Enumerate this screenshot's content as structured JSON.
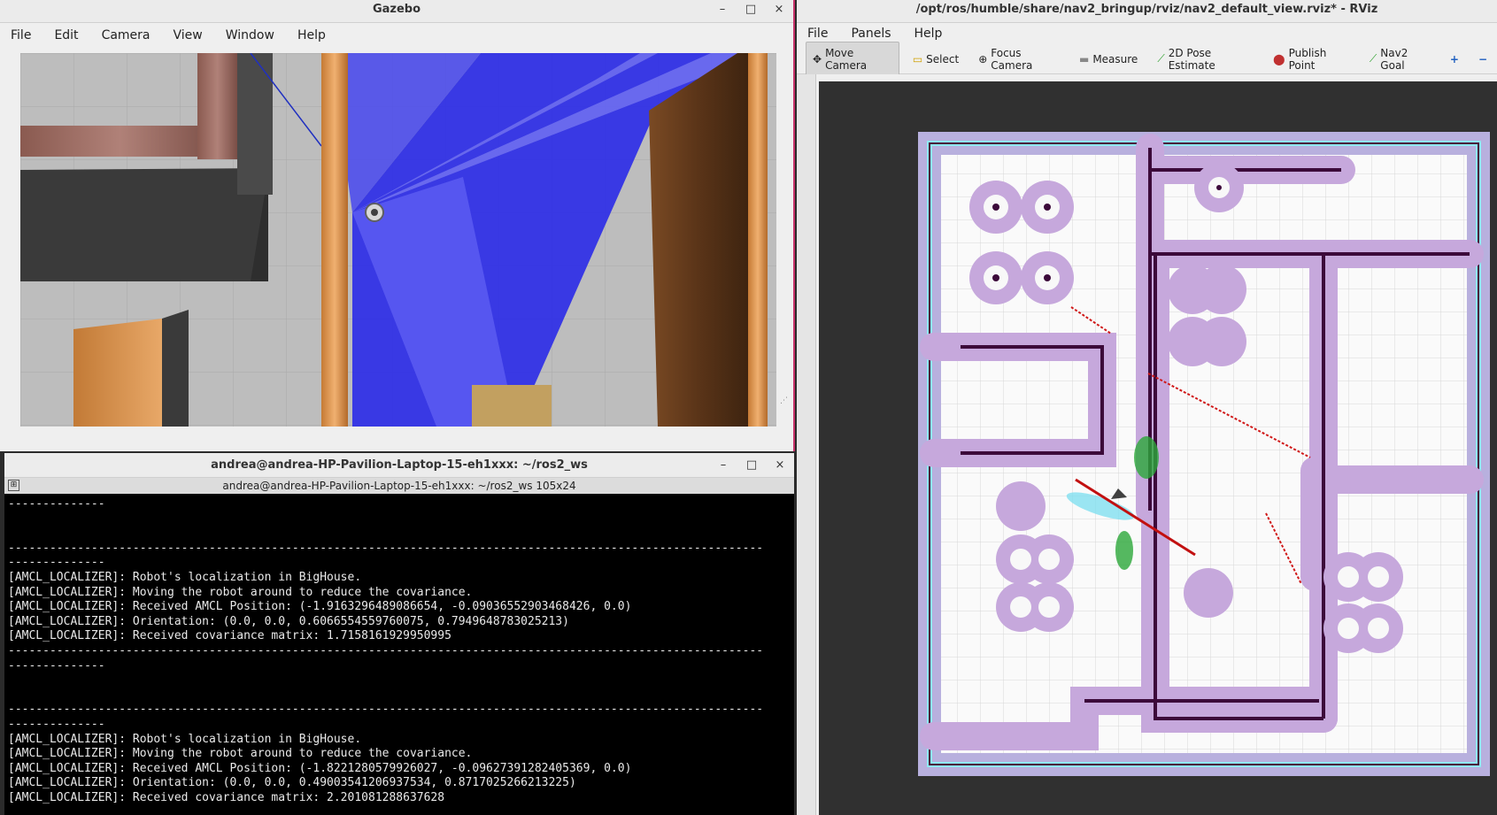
{
  "gazebo": {
    "title": "Gazebo",
    "menu": [
      "File",
      "Edit",
      "Camera",
      "View",
      "Window",
      "Help"
    ],
    "controls": {
      "minimize": "–",
      "maximize": "□",
      "close": "×"
    }
  },
  "terminal": {
    "title": "andrea@andrea-HP-Pavilion-Laptop-15-eh1xxx: ~/ros2_ws",
    "tab_title": "andrea@andrea-HP-Pavilion-Laptop-15-eh1xxx: ~/ros2_ws 105x24",
    "controls": {
      "minimize": "–",
      "maximize": "□",
      "close": "×"
    },
    "lines": [
      "--------------",
      "",
      "",
      "-------------------------------------------------------------------------------------------------------------",
      "--------------",
      "[AMCL_LOCALIZER]: Robot's localization in BigHouse.",
      "[AMCL_LOCALIZER]: Moving the robot around to reduce the covariance.",
      "[AMCL_LOCALIZER]: Received AMCL Position: (-1.9163296489086654, -0.09036552903468426, 0.0)",
      "[AMCL_LOCALIZER]: Orientation: (0.0, 0.0, 0.6066554559760075, 0.7949648783025213)",
      "[AMCL_LOCALIZER]: Received covariance matrix: 1.7158161929950995",
      "-------------------------------------------------------------------------------------------------------------",
      "--------------",
      "",
      "",
      "-------------------------------------------------------------------------------------------------------------",
      "--------------",
      "[AMCL_LOCALIZER]: Robot's localization in BigHouse.",
      "[AMCL_LOCALIZER]: Moving the robot around to reduce the covariance.",
      "[AMCL_LOCALIZER]: Received AMCL Position: (-1.8221280579926027, -0.09627391282405369, 0.0)",
      "[AMCL_LOCALIZER]: Orientation: (0.0, 0.0, 0.49003541206937534, 0.8717025266213225)",
      "[AMCL_LOCALIZER]: Received covariance matrix: 2.201081288637628"
    ]
  },
  "rviz": {
    "title": "/opt/ros/humble/share/nav2_bringup/rviz/nav2_default_view.rviz* - RViz",
    "menu": [
      "File",
      "Panels",
      "Help"
    ],
    "tools": [
      {
        "label": "Move Camera",
        "icon": "move-camera-icon",
        "glyph": "✥"
      },
      {
        "label": "Select",
        "icon": "select-icon",
        "glyph": "▭"
      },
      {
        "label": "Focus Camera",
        "icon": "focus-camera-icon",
        "glyph": "⊕"
      },
      {
        "label": "Measure",
        "icon": "measure-icon",
        "glyph": "▬"
      },
      {
        "label": "2D Pose Estimate",
        "icon": "pose-estimate-icon",
        "glyph": "⟋"
      },
      {
        "label": "Publish Point",
        "icon": "publish-point-icon",
        "glyph": "⬤"
      },
      {
        "label": "Nav2 Goal",
        "icon": "nav2-goal-icon",
        "glyph": "⟋"
      }
    ],
    "add_tool": "+",
    "remove_tool": "−"
  }
}
